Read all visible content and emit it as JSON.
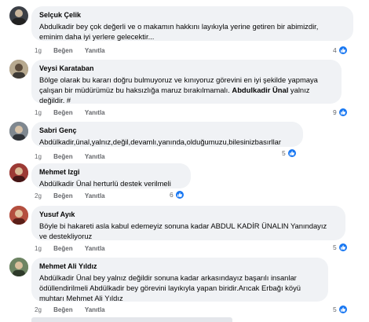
{
  "labels": {
    "like": "Beğen",
    "reply": "Yanıtla"
  },
  "comments": [
    {
      "author": "Selçuk Çelik",
      "lines": [
        "Abdulkadir bey çok değerli ve o makamın hakkını layıkıyla yerine getiren bir abimizdir,",
        "eminim daha iyi yerlere gelecektir..."
      ],
      "time": "1g",
      "reactions": "4",
      "avatar_color": "#3b3f46"
    },
    {
      "author": "Veysi Karataban",
      "lines": [
        "Bölge olarak bu kararı doğru bulmuyoruz ve kınıyoruz görevini en iyi şekilde yapmaya",
        "çalışan bir müdürümüz bu haksızlığa maruz bırakılmamalı."
      ],
      "bold_text": "Abdulkadir Ünal",
      "line2_tail": "yalnız",
      "line3": "değildir. #",
      "time": "1g",
      "reactions": "9",
      "avatar_color": "#8a7a66"
    },
    {
      "author": "Sabri Genç",
      "lines": [
        "Abdülkadir,ünal,yalnız,değil,devamlı,yanında,olduğumuzu,bilesinizbasırllar"
      ],
      "time": "1g",
      "reactions": "5",
      "avatar_color": "#6f7780"
    },
    {
      "author": "Mehmet Izgi",
      "lines": [
        "Abdülkadir Ünal herturlü destek verilmeli"
      ],
      "time": "2g",
      "reactions": "6",
      "avatar_color": "#8b2b2b"
    },
    {
      "author": "Yusuf Ayık",
      "lines": [
        "Böyle bi hakareti asla kabul edemeyiz sonuna kadar ABDUL KADİR ÜNALIN Yanındayız",
        "ve destekliyoruz"
      ],
      "time": "1g",
      "reactions": "5",
      "avatar_color": "#a0453a"
    },
    {
      "author": "Mehmet Ali Yıldız",
      "lines": [
        "Abdülkadir Ünal bey yalnız değildir sonuna kadar arkasındayız başarılı insanlar",
        "ödüllendirilmeli Abdülkadir bey görevini layıkıyla yapan biridir.Arıcak Erbağı köyü",
        "muhtarı Mehmet Ali Yıldız"
      ],
      "time": "2g",
      "reactions": "5",
      "avatar_color": "#5a6f52"
    }
  ],
  "colors": {
    "like_blue": "#1877f2",
    "bubble_bg": "#f0f2f5",
    "meta_gray": "#65676b"
  }
}
